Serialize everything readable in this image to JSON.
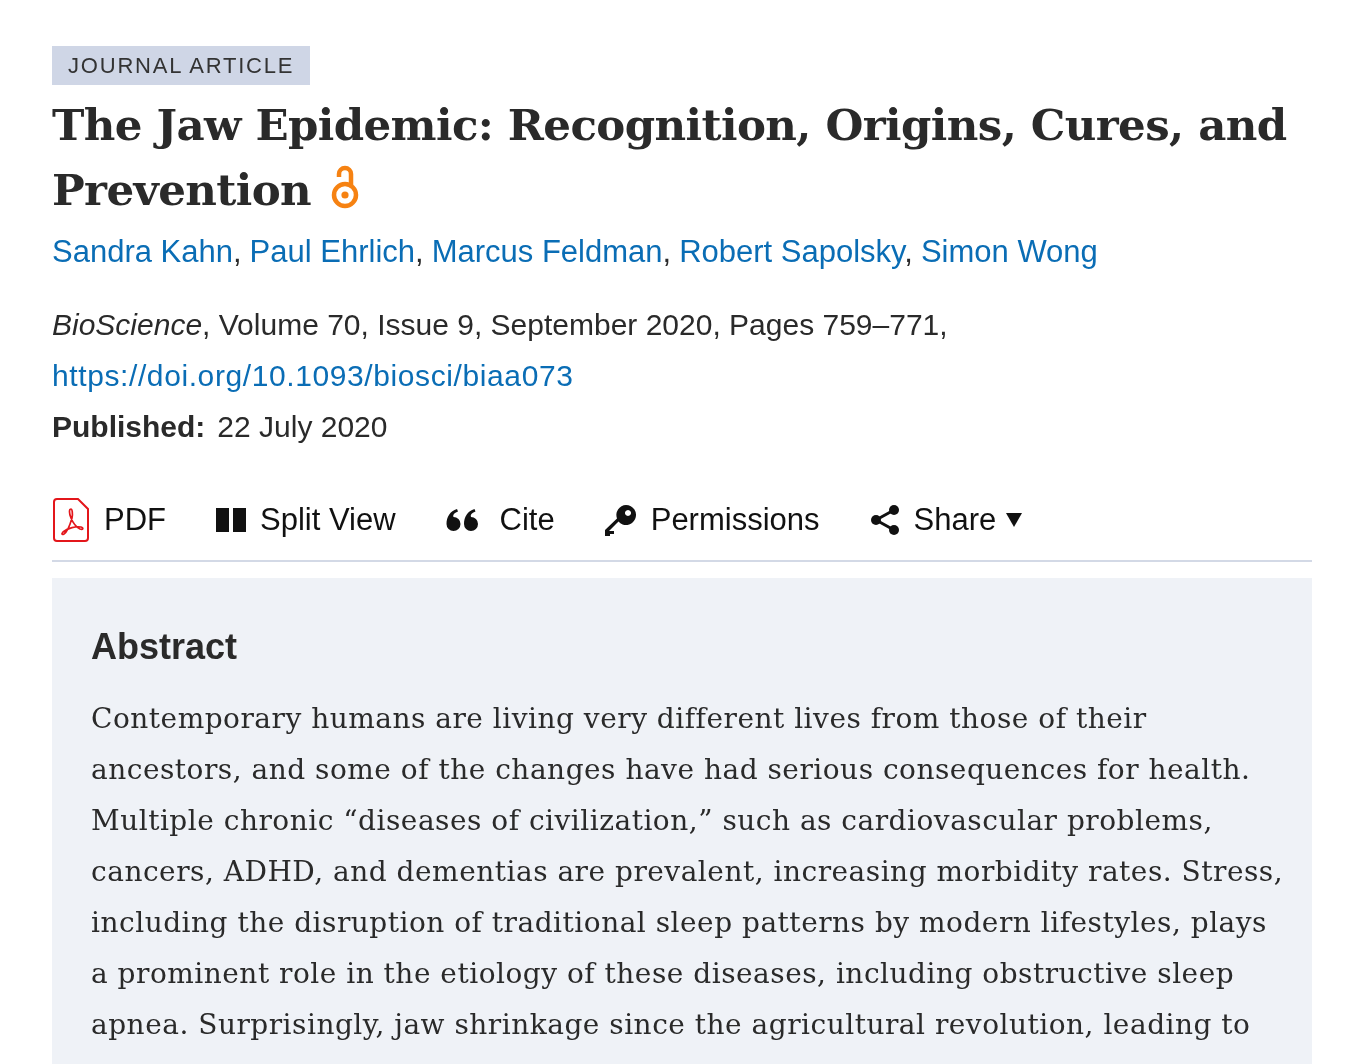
{
  "article_type": "JOURNAL ARTICLE",
  "title": "The Jaw Epidemic: Recognition, Origins, Cures, and Prevention",
  "open_access": true,
  "authors": [
    {
      "name": "Sandra Kahn",
      "separator": ","
    },
    {
      "name": "Paul Ehrlich",
      "separator": ","
    },
    {
      "name": "Marcus Feldman",
      "separator": ","
    },
    {
      "name": "Robert Sapolsky",
      "separator": ","
    },
    {
      "name": "Simon Wong"
    }
  ],
  "citation": "*BioScience*, Volume 70, Issue 9, September 2020, Pages 759–771,",
  "doi": "https://doi.org/10.1093/biosci/biaa073",
  "published": {
    "label": "Published:",
    "date": "22 July 2020"
  },
  "toolbar": [
    {
      "kind": "pdf",
      "label": "PDF"
    },
    {
      "kind": "split",
      "label": "Split View"
    },
    {
      "kind": "cite",
      "label": "Cite"
    },
    {
      "kind": "permissions",
      "label": "Permissions"
    },
    {
      "kind": "share",
      "label": "Share",
      "dropdown": true
    }
  ],
  "abstract": {
    "heading": "Abstract",
    "text": "Contemporary humans are living very different lives from those of their ancestors, and some of the changes have had serious consequences for health. Multiple chronic “diseases of civilization,” such as cardiovascular problems, cancers, ADHD, and dementias are prevalent, increasing morbidity rates. Stress, including the disruption of traditional sleep patterns by modern lifestyles, plays a prominent role in the etiology of these diseases, including obstructive sleep apnea. Surprisingly, jaw shrinkage since the agricultural revolution, leading to"
  }
}
